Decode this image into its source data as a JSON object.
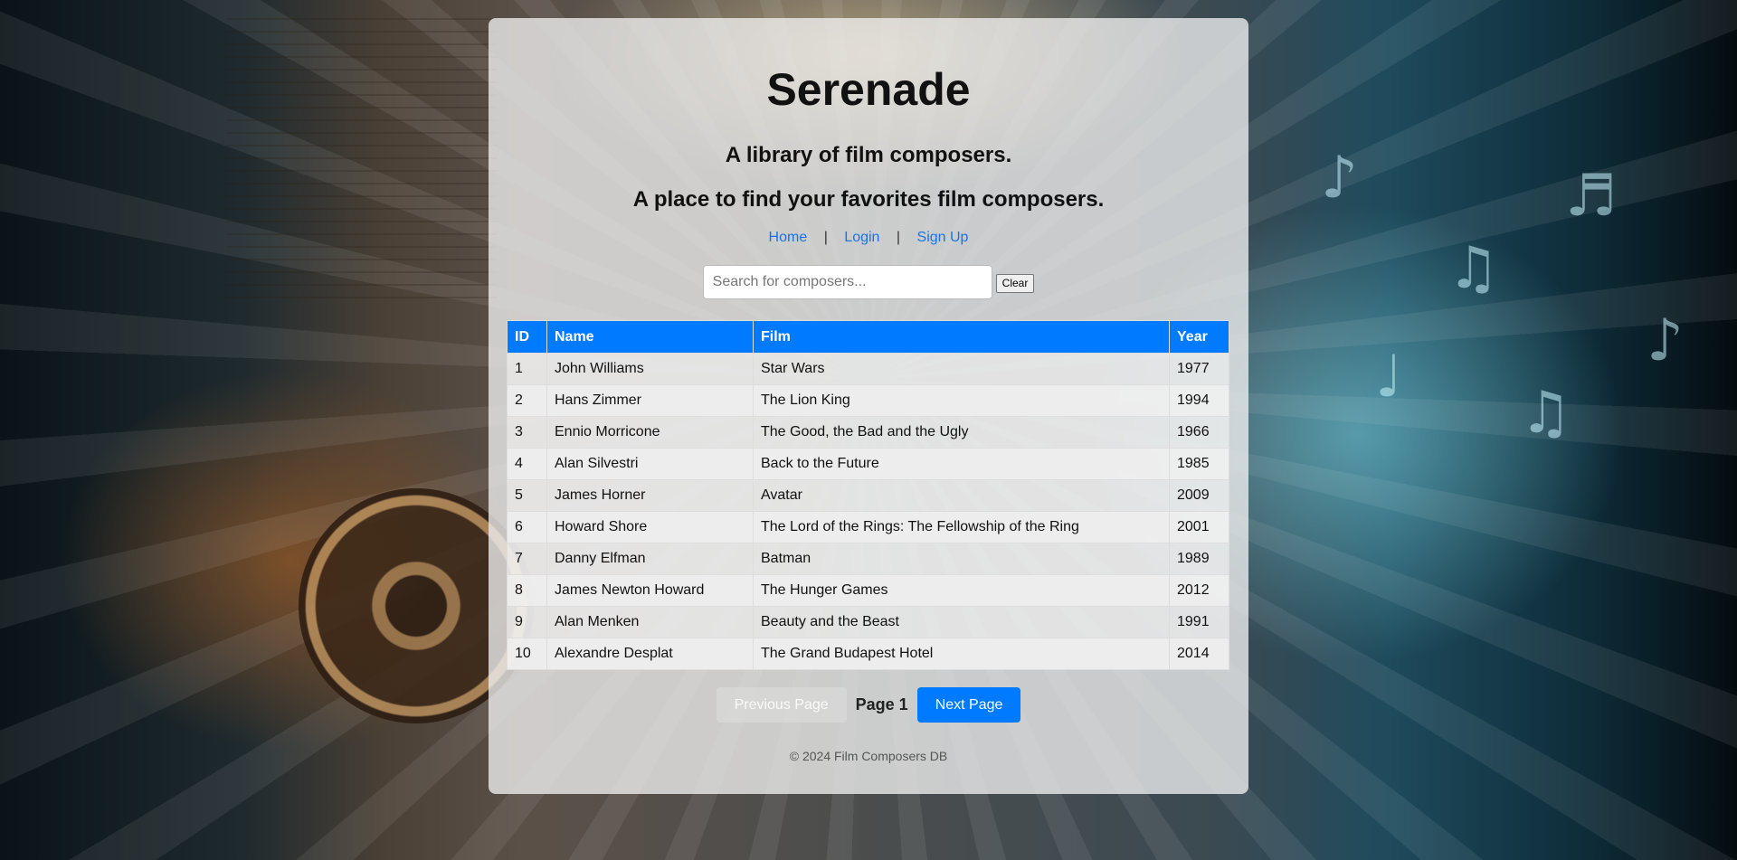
{
  "header": {
    "title": "Serenade",
    "tagline_1": "A library of film composers.",
    "tagline_2": "A place to find your favorites film composers."
  },
  "nav": {
    "home": "Home",
    "login": "Login",
    "signup": "Sign Up",
    "separator": "|"
  },
  "search": {
    "placeholder": "Search for composers...",
    "value": "",
    "clear_label": "Clear"
  },
  "table": {
    "headers": [
      "ID",
      "Name",
      "Film",
      "Year"
    ],
    "rows": [
      [
        "1",
        "John Williams",
        "Star Wars",
        "1977"
      ],
      [
        "2",
        "Hans Zimmer",
        "The Lion King",
        "1994"
      ],
      [
        "3",
        "Ennio Morricone",
        "The Good, the Bad and the Ugly",
        "1966"
      ],
      [
        "4",
        "Alan Silvestri",
        "Back to the Future",
        "1985"
      ],
      [
        "5",
        "James Horner",
        "Avatar",
        "2009"
      ],
      [
        "6",
        "Howard Shore",
        "The Lord of the Rings: The Fellowship of the Ring",
        "2001"
      ],
      [
        "7",
        "Danny Elfman",
        "Batman",
        "1989"
      ],
      [
        "8",
        "James Newton Howard",
        "The Hunger Games",
        "2012"
      ],
      [
        "9",
        "Alan Menken",
        "Beauty and the Beast",
        "1991"
      ],
      [
        "10",
        "Alexandre Desplat",
        "The Grand Budapest Hotel",
        "2014"
      ]
    ]
  },
  "pagination": {
    "prev_label": "Previous Page",
    "page_label": "Page 1",
    "next_label": "Next Page"
  },
  "footer": {
    "text": "© 2024 Film Composers DB"
  },
  "colors": {
    "accent": "#007bff",
    "link": "#1a73e8"
  }
}
